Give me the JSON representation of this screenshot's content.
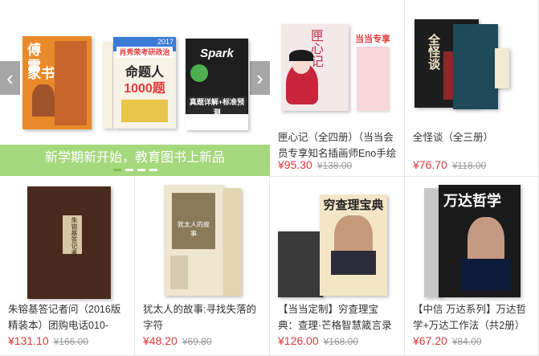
{
  "banner": {
    "caption": "新学期新开始，教育图书上新品",
    "prev_icon": "chevron-left-icon",
    "next_icon": "chevron-right-icon",
    "books": [
      {
        "main": "傅雷",
        "sub": "家书"
      },
      {
        "main": "命题人",
        "sub": "1000题",
        "top": "肖秀荣考研政治",
        "year": "2017"
      },
      {
        "main": "Spark",
        "sub": "真题详解+标准预测"
      }
    ],
    "slides_total": 4,
    "slide_active": 1
  },
  "products": [
    {
      "cover_text": "匣心记",
      "badge": "当当专享",
      "title": "匣心记（全四册）（当当会员专享知名插画师Eno手绘",
      "price": "¥95.30",
      "old_price": "¥138.00"
    },
    {
      "cover_text": "全怪谈",
      "title": "全怪谈（全三册）",
      "price": "¥76.70",
      "old_price": "¥118.00"
    },
    {
      "cover_text": "朱镕基答记者问",
      "title": "朱镕基答记者问（2016版精装本）团购电话010-",
      "price": "¥131.10",
      "old_price": "¥166.00"
    },
    {
      "cover_text": "犹太人的故事",
      "title": "犹太人的故事:寻找失落的字符",
      "price": "¥48.20",
      "old_price": "¥69.80"
    },
    {
      "cover_text": "穷查理宝典",
      "title": "【当当定制】穷查理宝典：查理·芒格智慧箴言录（增订",
      "price": "¥126.00",
      "old_price": "¥168.00"
    },
    {
      "cover_text": "万达哲学",
      "title": "【中信 万达系列】万达哲学+万达工作法（共2册）",
      "price": "¥67.20",
      "old_price": "¥84.00"
    }
  ]
}
